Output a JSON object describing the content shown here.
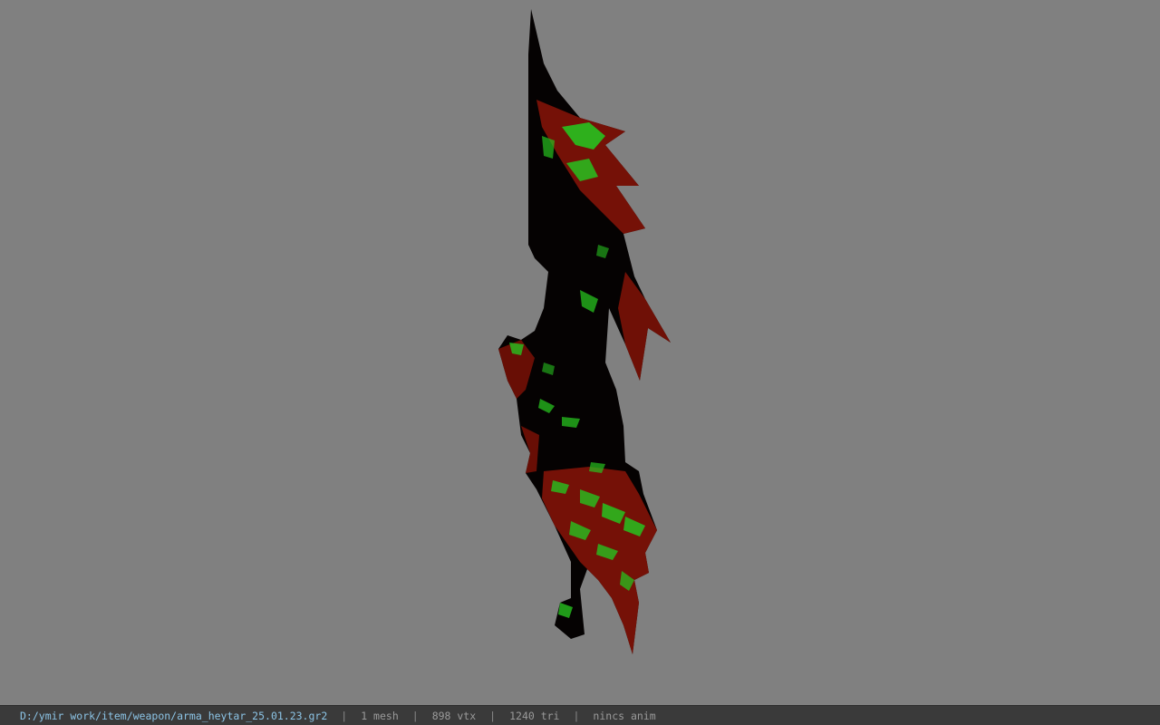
{
  "viewport": {
    "background_color": "#808080",
    "model_colors": {
      "dark": "#050202",
      "red": "#8a1408",
      "red_bright": "#b01e0c",
      "green": "#27c21f"
    }
  },
  "statusbar": {
    "file_path": "D:/ymir work/item/weapon/arma_heytar_25.01.23.gr2",
    "separator": "|",
    "mesh_count": "1 mesh",
    "vertex_count": "898 vtx",
    "triangle_count": "1240 tri",
    "anim_status": "nincs anim"
  }
}
